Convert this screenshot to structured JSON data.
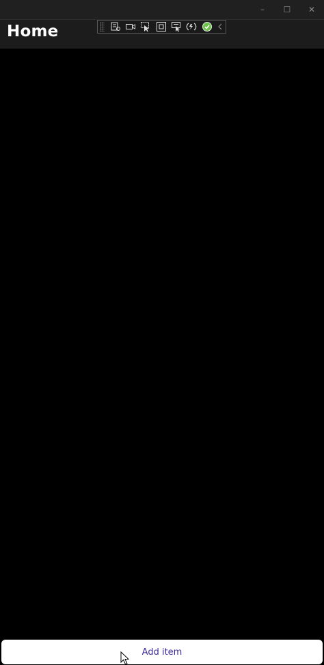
{
  "window": {
    "controls": [
      {
        "name": "minimize-icon",
        "glyph": "–"
      },
      {
        "name": "maximize-icon",
        "glyph": "☐"
      },
      {
        "name": "close-icon",
        "glyph": "✕"
      }
    ]
  },
  "header": {
    "title": "Home"
  },
  "debug_toolbar": {
    "icons": [
      "live-visual-tree-icon",
      "video-capture-icon",
      "select-element-icon",
      "display-layout-adorners-icon",
      "track-focus-icon",
      "hot-reload-icon",
      "checkmark-status-icon",
      "collapse-toolbar-icon"
    ],
    "status_color": "#6cc24a"
  },
  "footer": {
    "add_item_label": "Add item",
    "label_color": "#3c2a9a"
  }
}
